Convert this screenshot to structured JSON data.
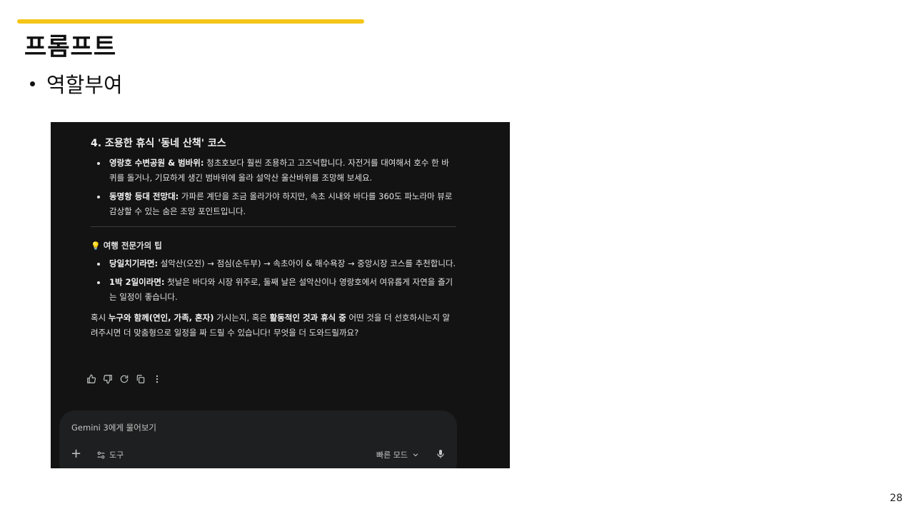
{
  "slide": {
    "title": "프롬프트",
    "bullet": "역할부여",
    "page_number": "28",
    "accent_color": "#f5c518"
  },
  "chat": {
    "section_heading": "4. 조용한 휴식 '동네 산책' 코스",
    "items": [
      {
        "bold": "영랑호 수변공원 & 범바위:",
        "text": " 청초호보다 훨씬 조용하고 고즈넉합니다. 자전거를 대여해서 호수 한 바퀴를 돌거나, 기묘하게 생긴 범바위에 올라 설악산 울산바위를 조망해 보세요."
      },
      {
        "bold": "동명항 등대 전망대:",
        "text": " 가파른 계단을 조금 올라가야 하지만, 속초 시내와 바다를 360도 파노라마 뷰로 감상할 수 있는 숨은 조망 포인트입니다."
      }
    ],
    "tip_title": "여행 전문가의 팁",
    "tips": [
      {
        "bold": "당일치기라면:",
        "text": " 설악산(오전) → 점심(순두부) → 속초아이 & 해수욕장 → 중앙시장 코스를 추천합니다."
      },
      {
        "bold": "1박 2일이라면:",
        "text": " 첫날은 바다와 시장 위주로, 둘째 날은 설악산이나 영랑호에서 여유롭게 자연을 즐기는 일정이 좋습니다."
      }
    ],
    "closing": {
      "p1": "혹시 ",
      "b1": "누구와 함께(연인, 가족, 혼자)",
      "p2": " 가시는지, 혹은 ",
      "b2": "활동적인 것과 휴식 중",
      "p3": " 어떤 것을 더 선호하시는지 알려주시면 더 맞춤형으로 일정을 짜 드릴 수 있습니다! 무엇을 더 도와드릴까요?"
    },
    "action_icons": [
      "thumbs-up-icon",
      "thumbs-down-icon",
      "regenerate-icon",
      "copy-icon",
      "more-icon"
    ],
    "input": {
      "placeholder": "Gemini 3에게 물어보기",
      "add_icon": "+",
      "tools_label": "도구",
      "mode_label": "빠른 모드"
    },
    "colors": {
      "panel_bg": "#131314",
      "input_bg": "#1e1f20",
      "text": "#e3e3e3"
    }
  }
}
